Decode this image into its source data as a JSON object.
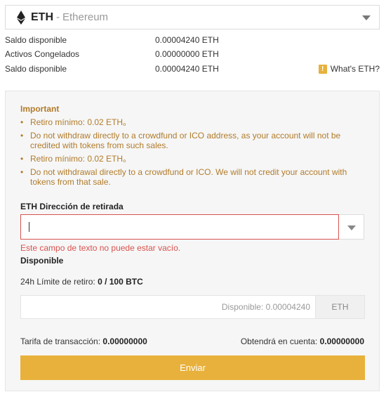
{
  "coin": {
    "symbol": "ETH",
    "separator": "-",
    "name": "Ethereum",
    "icon": "ethereum-icon"
  },
  "balances": [
    {
      "label": "Saldo disponible",
      "value": "0.00004240 ETH"
    },
    {
      "label": "Activos Congelados",
      "value": "0.00000000 ETH"
    },
    {
      "label": "Saldo disponible",
      "value": "0.00004240 ETH"
    }
  ],
  "whats": {
    "label": "What's ETH?",
    "icon": "info-icon"
  },
  "important": {
    "title": "Important",
    "notes": [
      "Retiro mínimo: 0.02 ETH。",
      "Do not withdraw directly to a crowdfund or ICO address, as your account will not be credited with tokens from such sales.",
      "Retiro mínimo: 0.02 ETH。",
      "Do not withdrawal directly to a crowdfund or ICO. We will not credit your account with tokens from that sale."
    ]
  },
  "address": {
    "label": "ETH Dirección de retirada",
    "value": "",
    "error": "Este campo de texto no puede estar vacío."
  },
  "available_label": "Disponible",
  "limit": {
    "label": "24h Límite de retiro:",
    "value": "0 / 100 BTC"
  },
  "amount": {
    "placeholder": "Disponible: 0.00004240",
    "unit": "ETH"
  },
  "fee": {
    "label": "Tarifa de transacción:",
    "value": "0.00000000"
  },
  "receive": {
    "label": "Obtendrá en cuenta:",
    "value": "0.00000000"
  },
  "submit_label": "Enviar",
  "colors": {
    "accent": "#e8b13c",
    "warning_text": "#b17b2a",
    "error": "#d9534f"
  }
}
